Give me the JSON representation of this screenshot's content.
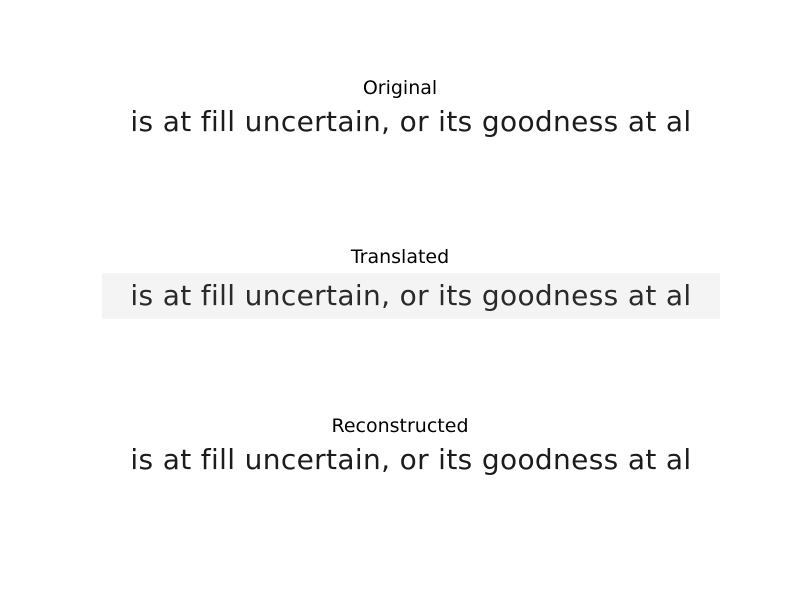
{
  "panels": [
    {
      "title": "Original",
      "text": "is at fill uncertain, or its goodness at al"
    },
    {
      "title": "Translated",
      "text": "is at fill uncertain, or its goodness at al"
    },
    {
      "title": "Reconstructed",
      "text": "is at fill uncertain, or its goodness at al"
    }
  ]
}
